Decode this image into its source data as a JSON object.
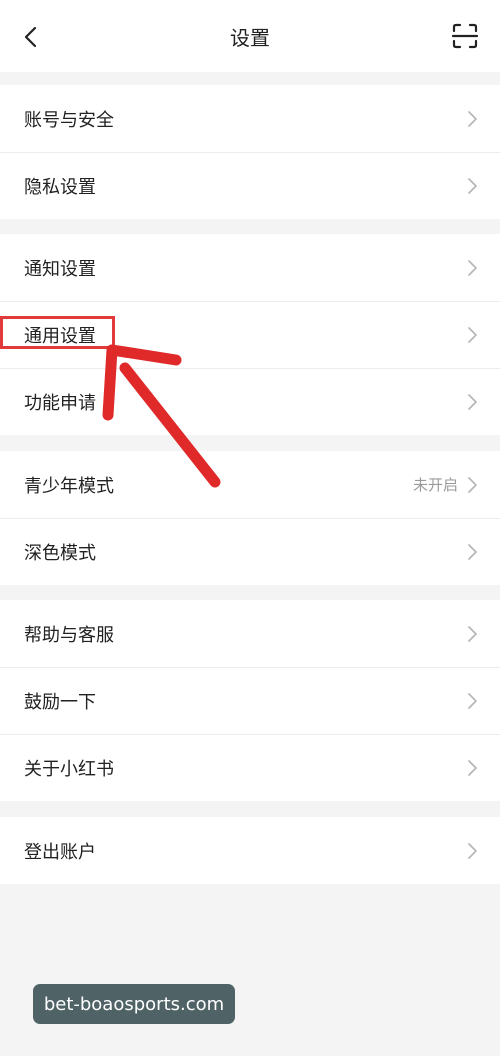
{
  "header": {
    "title": "设置",
    "back_icon": "back-arrow-icon",
    "scan_icon": "scan-icon"
  },
  "groups": [
    {
      "items": [
        {
          "label": "账号与安全"
        },
        {
          "label": "隐私设置"
        }
      ]
    },
    {
      "items": [
        {
          "label": "通知设置"
        },
        {
          "label": "通用设置"
        },
        {
          "label": "功能申请"
        }
      ]
    },
    {
      "items": [
        {
          "label": "青少年模式",
          "value": "未开启"
        },
        {
          "label": "深色模式"
        }
      ]
    },
    {
      "items": [
        {
          "label": "帮助与客服"
        },
        {
          "label": "鼓励一下"
        },
        {
          "label": "关于小红书"
        }
      ]
    },
    {
      "items": [
        {
          "label": "登出账户"
        }
      ]
    }
  ],
  "annotation": {
    "highlight_color": "#e03a3a",
    "arrow_color": "#e02a2a",
    "highlighted_item": "通用设置"
  },
  "watermark": {
    "text": "bet-boaosports.com"
  },
  "colors": {
    "background": "#f4f4f4",
    "row_background": "#ffffff",
    "chevron": "#b8b8b8"
  }
}
